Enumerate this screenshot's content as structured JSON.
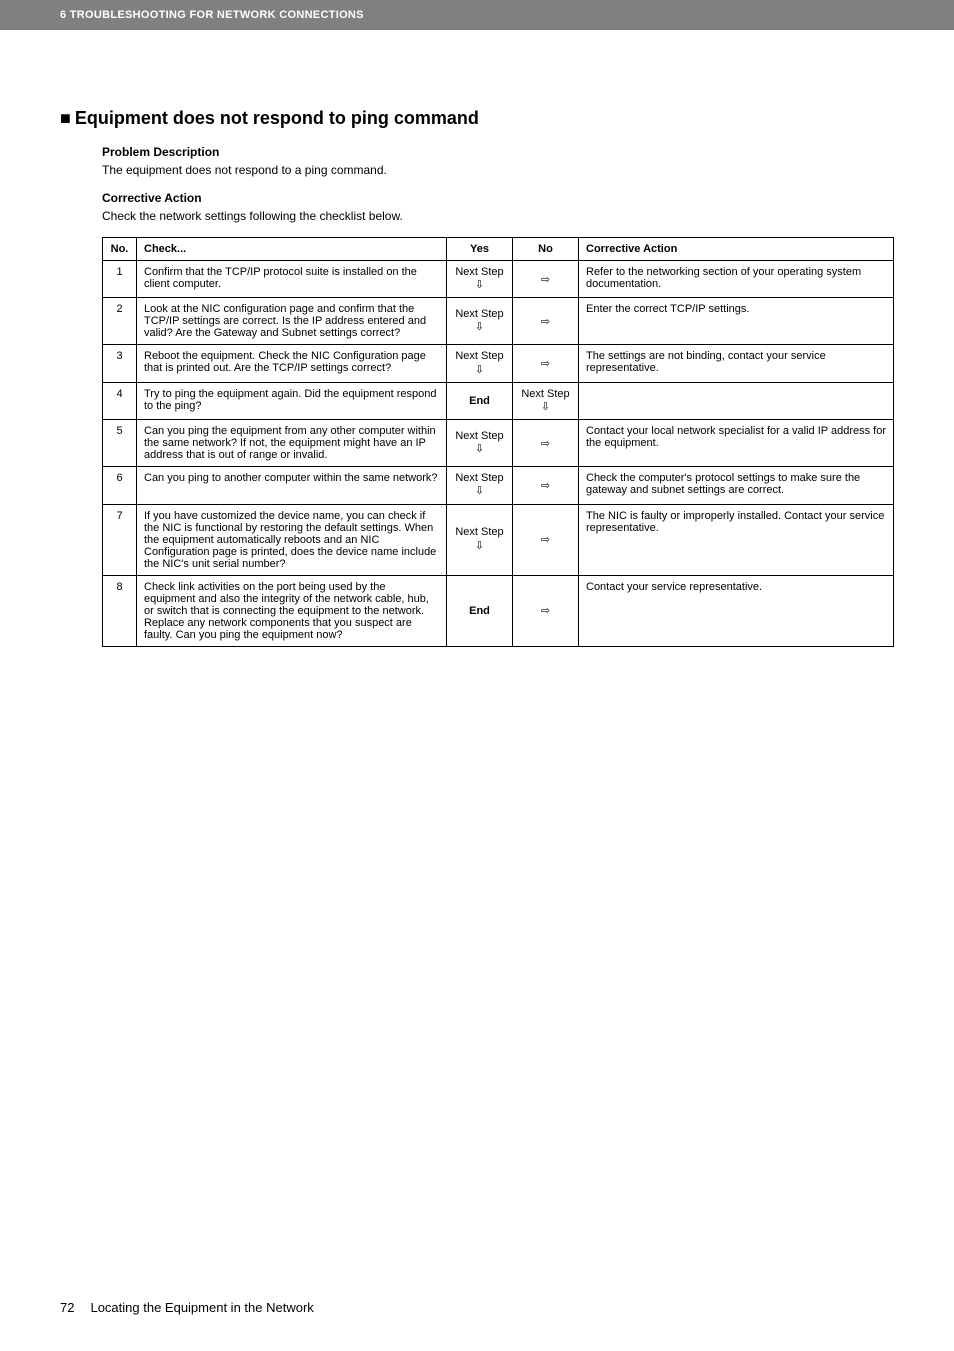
{
  "header": {
    "text": "6 TROUBLESHOOTING FOR NETWORK CONNECTIONS"
  },
  "section": {
    "bullet": "■",
    "title": "Equipment does not respond to ping command",
    "problem_label": "Problem Description",
    "problem_text": "The equipment does not respond to a ping command.",
    "corrective_label": "Corrective Action",
    "corrective_text": "Check the network settings following the checklist below."
  },
  "table": {
    "headers": {
      "no": "No.",
      "check": "Check...",
      "yes": "Yes",
      "no_col": "No",
      "action": "Corrective Action"
    },
    "next_step": "Next Step",
    "end": "End",
    "arrow_down": "⇩",
    "arrow_right": "⇨",
    "rows": [
      {
        "no": "1",
        "check": "Confirm that the TCP/IP protocol suite is installed on the client computer.",
        "yes_type": "next",
        "no_type": "right",
        "action": "Refer to the networking section of your operating system documentation."
      },
      {
        "no": "2",
        "check": "Look at the NIC configuration page and confirm that the TCP/IP settings are correct. Is the IP address entered and valid? Are the Gateway and Subnet settings correct?",
        "yes_type": "next",
        "no_type": "right",
        "action": "Enter the correct TCP/IP settings."
      },
      {
        "no": "3",
        "check": "Reboot the equipment. Check the NIC Configuration page that is printed out. Are the TCP/IP settings correct?",
        "yes_type": "next",
        "no_type": "right",
        "action": "The settings are not binding, contact your service representative."
      },
      {
        "no": "4",
        "check": "Try to ping the equipment again. Did the equipment respond to the ping?",
        "yes_type": "end",
        "no_type": "next",
        "action": ""
      },
      {
        "no": "5",
        "check": "Can you ping the equipment from any other computer within the same network? If not, the equipment might have an IP address that is out of range or invalid.",
        "yes_type": "next",
        "no_type": "right",
        "action": "Contact your local network specialist for a valid IP address for the equipment."
      },
      {
        "no": "6",
        "check": "Can you ping to another computer within the same network?",
        "yes_type": "next",
        "no_type": "right",
        "action": "Check the computer's protocol settings to make sure the gateway and subnet settings are correct."
      },
      {
        "no": "7",
        "check": "If you have customized the device name, you can check if the NIC is functional by restoring the default settings. When the equipment automatically reboots and an NIC Configuration page is printed, does the device name include the NIC's unit serial number?",
        "yes_type": "next",
        "no_type": "right",
        "action": "The NIC is faulty or improperly installed. Contact your service representative."
      },
      {
        "no": "8",
        "check": "Check link activities on the port being used by the equipment and also the integrity of the network cable, hub, or switch that is connecting the equipment to the network. Replace any network components that you suspect are faulty. Can you ping the equipment now?",
        "yes_type": "end",
        "no_type": "right",
        "action": "Contact your service representative."
      }
    ]
  },
  "footer": {
    "page": "72",
    "text": "Locating the Equipment in the Network"
  }
}
